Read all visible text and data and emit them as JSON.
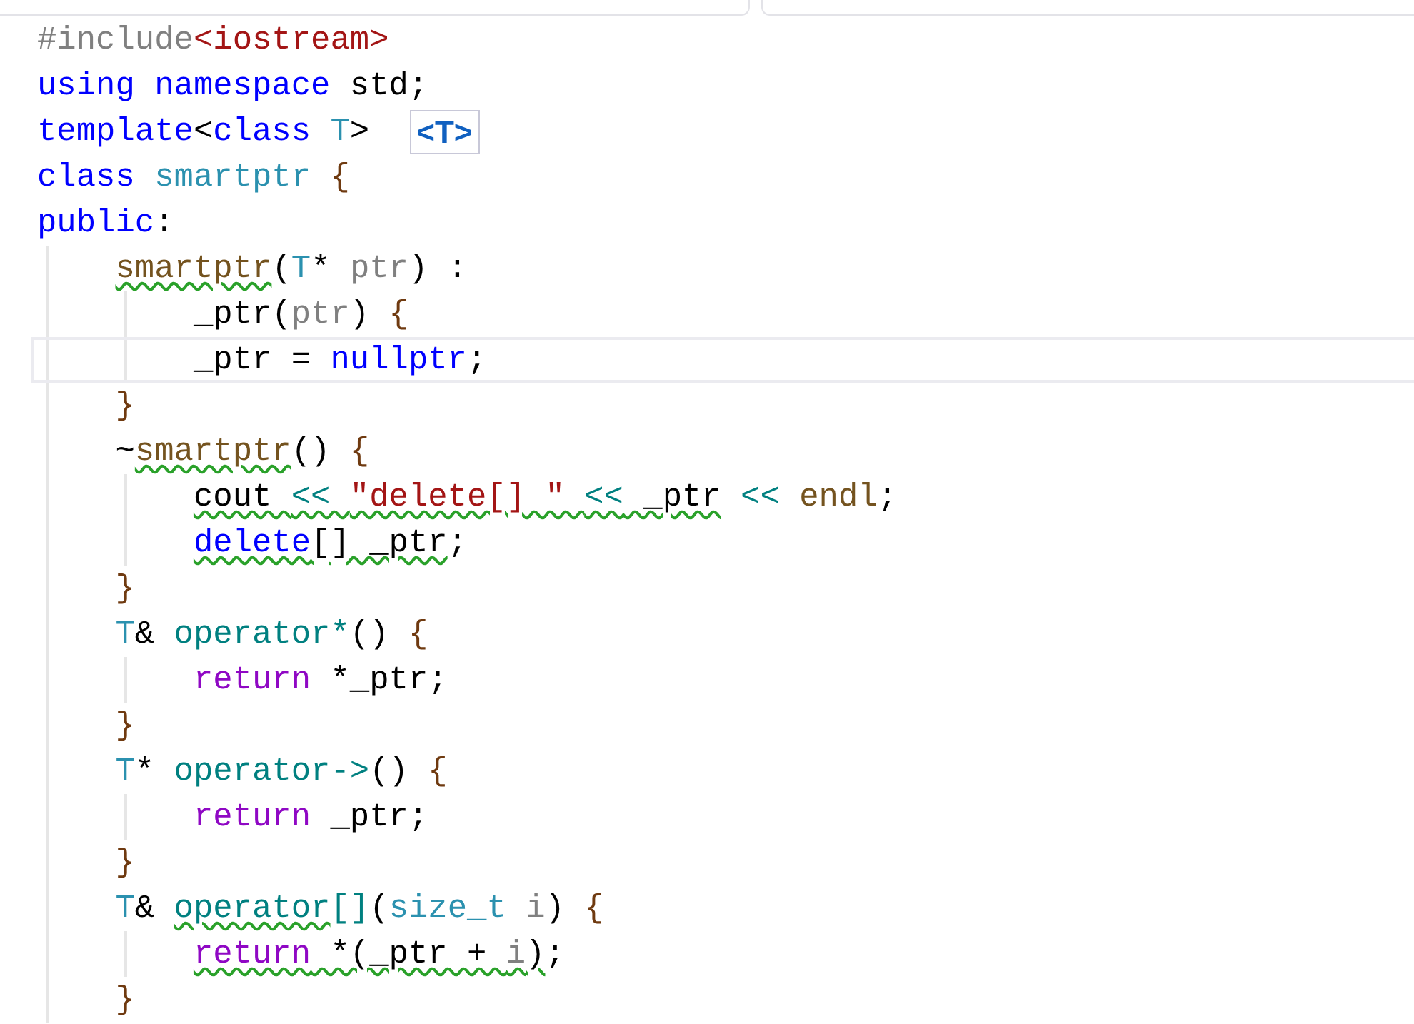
{
  "lines": [
    {
      "tokens": [
        {
          "kind": "preproc",
          "text": "#include"
        },
        {
          "kind": "include",
          "text": "<iostream>"
        }
      ]
    },
    {
      "tokens": [
        {
          "kind": "keyword",
          "text": "using "
        },
        {
          "kind": "keyword",
          "text": "namespace"
        },
        {
          "kind": "plain",
          "text": " std;"
        }
      ]
    },
    {
      "tokens": [
        {
          "kind": "keyword",
          "text": "template"
        },
        {
          "kind": "plain",
          "text": "<"
        },
        {
          "kind": "keyword",
          "text": "class "
        },
        {
          "kind": "type",
          "text": "T"
        },
        {
          "kind": "plain",
          "text": ">"
        }
      ],
      "hint": "<T>"
    },
    {
      "tokens": [
        {
          "kind": "keyword",
          "text": "class "
        },
        {
          "kind": "type",
          "text": "smartptr "
        },
        {
          "kind": "brace",
          "text": "{"
        }
      ]
    },
    {
      "tokens": [
        {
          "kind": "keyword",
          "text": "public"
        },
        {
          "kind": "plain",
          "text": ":"
        }
      ]
    },
    {
      "tokens": [
        {
          "kind": "function",
          "text": "    smartptr",
          "squiggle": true
        },
        {
          "kind": "plain",
          "text": "("
        },
        {
          "kind": "type",
          "text": "T"
        },
        {
          "kind": "plain",
          "text": "* "
        },
        {
          "kind": "param",
          "text": "ptr"
        },
        {
          "kind": "plain",
          "text": ") :"
        }
      ]
    },
    {
      "tokens": [
        {
          "kind": "plain",
          "text": "        _ptr("
        },
        {
          "kind": "param",
          "text": "ptr"
        },
        {
          "kind": "plain",
          "text": ") "
        },
        {
          "kind": "brace",
          "text": "{"
        }
      ]
    },
    {
      "tokens": [
        {
          "kind": "plain",
          "text": "        _ptr = "
        },
        {
          "kind": "keyword",
          "text": "nullptr"
        },
        {
          "kind": "plain",
          "text": ";"
        }
      ],
      "current": true
    },
    {
      "tokens": [
        {
          "kind": "brace",
          "text": "    }"
        }
      ]
    },
    {
      "tokens": [
        {
          "kind": "plain",
          "text": "    ~"
        },
        {
          "kind": "function",
          "text": "smartptr",
          "squiggle": true
        },
        {
          "kind": "plain",
          "text": "() "
        },
        {
          "kind": "brace",
          "text": "{"
        }
      ]
    },
    {
      "tokens": [
        {
          "kind": "plain",
          "text": "        cout ",
          "squiggle": true
        },
        {
          "kind": "operator",
          "text": "<< ",
          "squiggle": true
        },
        {
          "kind": "string",
          "text": "\"delete[] \" ",
          "squiggle": true
        },
        {
          "kind": "operator",
          "text": "<<",
          "squiggle": true
        },
        {
          "kind": "plain",
          "text": " _ptr",
          "squiggle": true
        },
        {
          "kind": "operator",
          "text": " << "
        },
        {
          "kind": "function",
          "text": "endl"
        },
        {
          "kind": "plain",
          "text": ";"
        }
      ]
    },
    {
      "tokens": [
        {
          "kind": "keyword",
          "text": "        delete",
          "squiggle": true
        },
        {
          "kind": "plain",
          "text": "[] _ptr",
          "squiggle": true
        },
        {
          "kind": "plain",
          "text": ";"
        }
      ]
    },
    {
      "tokens": [
        {
          "kind": "brace",
          "text": "    }"
        }
      ]
    },
    {
      "tokens": [
        {
          "kind": "type",
          "text": "    T"
        },
        {
          "kind": "plain",
          "text": "& "
        },
        {
          "kind": "member",
          "text": "operator*"
        },
        {
          "kind": "plain",
          "text": "() "
        },
        {
          "kind": "brace",
          "text": "{"
        }
      ]
    },
    {
      "tokens": [
        {
          "kind": "control",
          "text": "        return"
        },
        {
          "kind": "plain",
          "text": " *_ptr;"
        }
      ]
    },
    {
      "tokens": [
        {
          "kind": "brace",
          "text": "    }"
        }
      ]
    },
    {
      "tokens": [
        {
          "kind": "type",
          "text": "    T"
        },
        {
          "kind": "plain",
          "text": "* "
        },
        {
          "kind": "member",
          "text": "operator->"
        },
        {
          "kind": "plain",
          "text": "() "
        },
        {
          "kind": "brace",
          "text": "{"
        }
      ]
    },
    {
      "tokens": [
        {
          "kind": "control",
          "text": "        return"
        },
        {
          "kind": "plain",
          "text": " _ptr;"
        }
      ]
    },
    {
      "tokens": [
        {
          "kind": "brace",
          "text": "    }"
        }
      ]
    },
    {
      "tokens": [
        {
          "kind": "type",
          "text": "    T"
        },
        {
          "kind": "plain",
          "text": "& "
        },
        {
          "kind": "member",
          "text": "operator",
          "squiggle": true
        },
        {
          "kind": "member",
          "text": "[]"
        },
        {
          "kind": "plain",
          "text": "("
        },
        {
          "kind": "type",
          "text": "size_t "
        },
        {
          "kind": "param",
          "text": "i"
        },
        {
          "kind": "plain",
          "text": ") "
        },
        {
          "kind": "brace",
          "text": "{"
        }
      ]
    },
    {
      "tokens": [
        {
          "kind": "control",
          "text": "        return",
          "squiggle": true
        },
        {
          "kind": "plain",
          "text": " *(_ptr + ",
          "squiggle": true
        },
        {
          "kind": "param",
          "text": "i",
          "squiggle": true
        },
        {
          "kind": "plain",
          "text": ")",
          "squiggle": true
        },
        {
          "kind": "plain",
          "text": ";"
        }
      ]
    },
    {
      "tokens": [
        {
          "kind": "brace",
          "text": "    }"
        }
      ]
    }
  ]
}
